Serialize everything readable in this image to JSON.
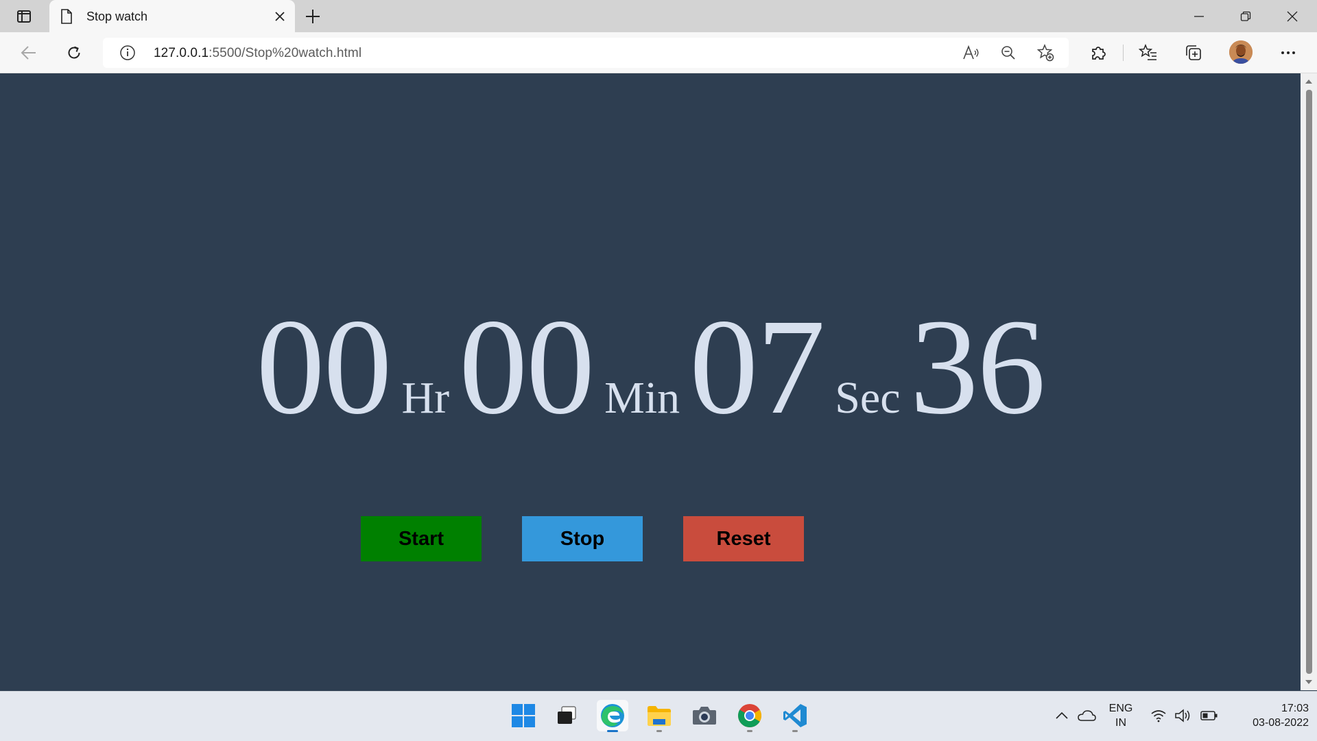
{
  "browser": {
    "tab_title": "Stop watch",
    "url_host": "127.0.0.1",
    "url_rest": ":5500/Stop%20watch.html"
  },
  "stopwatch": {
    "hours": "00",
    "hours_unit": "Hr",
    "minutes": "00",
    "minutes_unit": "Min",
    "seconds": "07",
    "seconds_unit": "Sec",
    "centiseconds": "36",
    "text_color": "#d7e0ee",
    "background_color": "#2e3e51"
  },
  "controls": {
    "start_label": "Start",
    "start_color": "#008000",
    "stop_label": "Stop",
    "stop_color": "#3498db",
    "reset_label": "Reset",
    "reset_color": "#c94c3d"
  },
  "taskbar": {
    "language": "ENG",
    "region": "IN",
    "time": "17:03",
    "date": "03-08-2022",
    "apps": [
      "start-icon",
      "task-view-icon",
      "edge-icon",
      "file-explorer-icon",
      "camera-icon",
      "chrome-icon",
      "vscode-icon"
    ]
  }
}
